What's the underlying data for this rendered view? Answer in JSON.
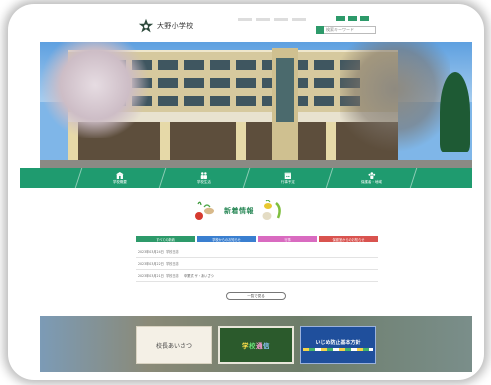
{
  "header": {
    "school_name": "大野小学校",
    "search_placeholder": "検索キーワード"
  },
  "nav": {
    "items": [
      {
        "label": "学校概要",
        "icon": "school-icon"
      },
      {
        "label": "学校生活",
        "icon": "people-icon"
      },
      {
        "label": "行事予定",
        "icon": "calendar-icon"
      },
      {
        "label": "保護者・地域",
        "icon": "group-icon"
      }
    ]
  },
  "news": {
    "title": "新着情報",
    "tabs": [
      {
        "label": "すべての新着",
        "color": "#2d9a6a"
      },
      {
        "label": "学校からのお知らせ",
        "color": "#3a7fd0"
      },
      {
        "label": "行事",
        "color": "#d96bc0"
      },
      {
        "label": "保健室からのお知らせ",
        "color": "#d9534f"
      }
    ],
    "items": [
      {
        "date": "2023年03月24日",
        "category": "学校日誌",
        "text": ""
      },
      {
        "date": "2023年03月22日",
        "category": "学校日誌",
        "text": ""
      },
      {
        "date": "2023年03月21日",
        "category": "学校日誌",
        "text": "卒業式 ザ・あいざつ"
      }
    ],
    "more_label": "一覧で見る"
  },
  "banners": {
    "greeting": "校長あいさつ",
    "newsletter": [
      "学",
      "校",
      "通",
      "信"
    ],
    "bullying": "いじめ防止基本方針"
  },
  "colors": {
    "accent": "#1f9b6f",
    "tab_green": "#2d9a6a",
    "tab_blue": "#3a7fd0",
    "tab_pink": "#d96bc0",
    "tab_red": "#d9534f"
  }
}
